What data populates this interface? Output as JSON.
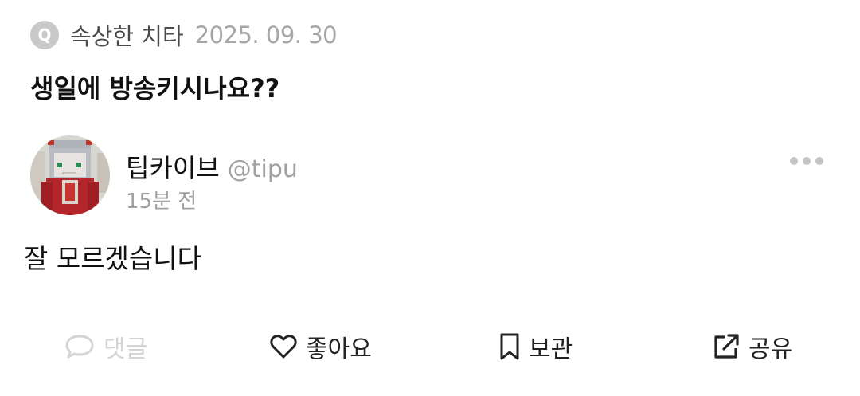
{
  "question": {
    "badge": "Q",
    "author": "속상한 치타",
    "date": "2025. 09. 30",
    "title": "생일에 방송키시나요??"
  },
  "answer": {
    "name": "팁카이브",
    "handle": "@tipu",
    "time": "15분 전",
    "body": "잘 모르겠습니다",
    "more_icon": "more-dots-icon"
  },
  "actions": {
    "comment_label": "댓글",
    "like_label": "좋아요",
    "save_label": "보관",
    "share_label": "공유"
  },
  "colors": {
    "primary_text": "#111111",
    "muted_text": "#a0a0a0",
    "disabled": "#d4d4d4",
    "badge_bg": "#c9c9c9"
  }
}
